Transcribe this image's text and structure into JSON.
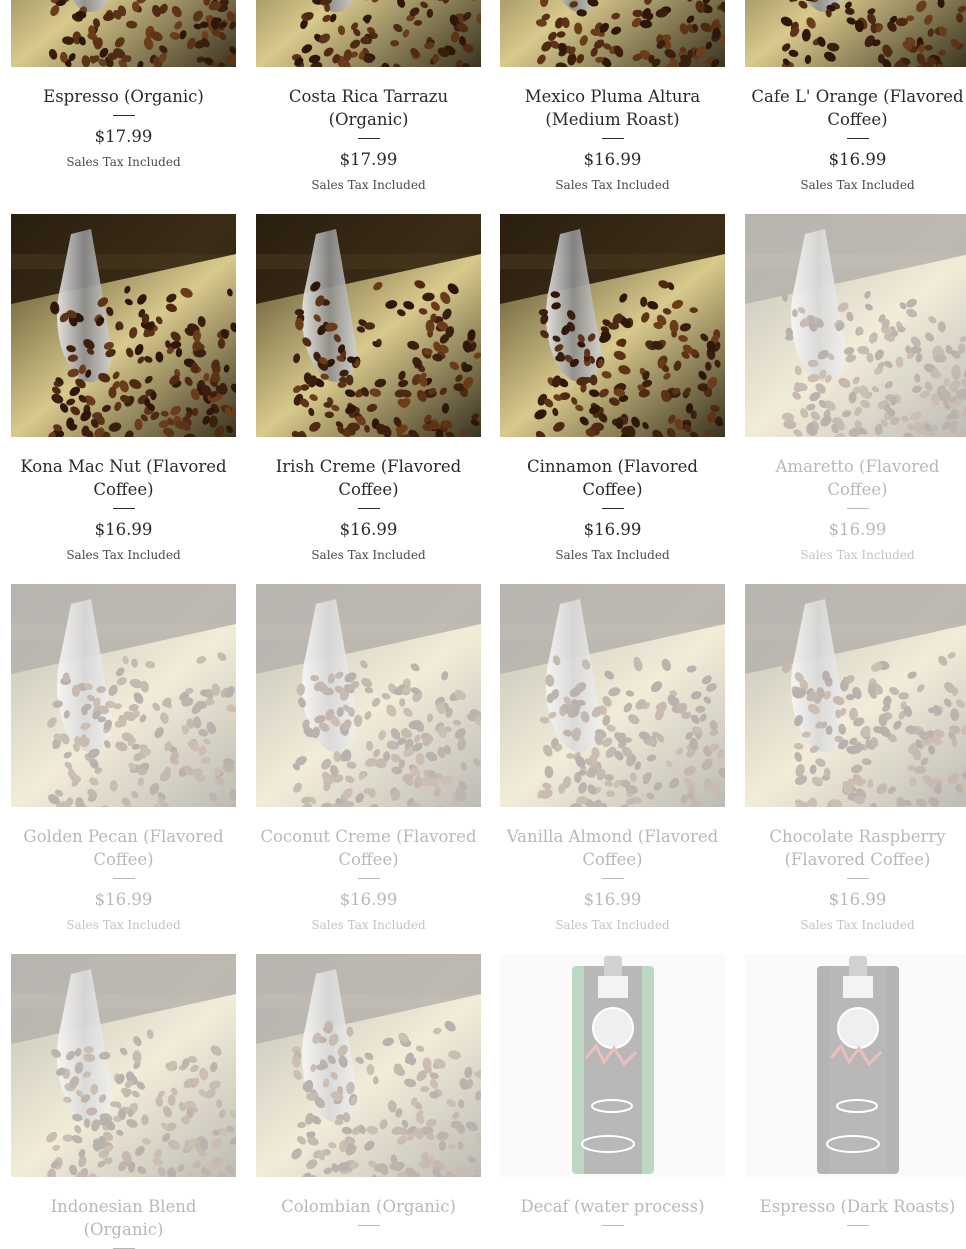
{
  "products": [
    {
      "title": "Espresso (Organic)",
      "price": "$17.99",
      "tax": "Sales Tax Included",
      "image": "coffee-scoop",
      "faded": false
    },
    {
      "title": "Costa Rica Tarrazu (Organic)",
      "price": "$17.99",
      "tax": "Sales Tax Included",
      "image": "coffee-scoop",
      "faded": false
    },
    {
      "title": "Mexico Pluma Altura (Medium Roast)",
      "price": "$16.99",
      "tax": "Sales Tax Included",
      "image": "coffee-scoop",
      "faded": false
    },
    {
      "title": "Cafe L' Orange (Flavored Coffee)",
      "price": "$16.99",
      "tax": "Sales Tax Included",
      "image": "coffee-scoop",
      "faded": false
    },
    {
      "title": "Kona Mac Nut (Flavored Coffee)",
      "price": "$16.99",
      "tax": "Sales Tax Included",
      "image": "coffee-scoop",
      "faded": false
    },
    {
      "title": "Irish Creme (Flavored Coffee)",
      "price": "$16.99",
      "tax": "Sales Tax Included",
      "image": "coffee-scoop",
      "faded": false
    },
    {
      "title": "Cinnamon (Flavored Coffee)",
      "price": "$16.99",
      "tax": "Sales Tax Included",
      "image": "coffee-scoop",
      "faded": false
    },
    {
      "title": "Amaretto (Flavored Coffee)",
      "price": "$16.99",
      "tax": "Sales Tax Included",
      "image": "coffee-scoop",
      "faded": true
    },
    {
      "title": "Golden Pecan (Flavored Coffee)",
      "price": "$16.99",
      "tax": "Sales Tax Included",
      "image": "coffee-scoop",
      "faded": true
    },
    {
      "title": "Coconut Creme (Flavored Coffee)",
      "price": "$16.99",
      "tax": "Sales Tax Included",
      "image": "coffee-scoop",
      "faded": true
    },
    {
      "title": "Vanilla Almond (Flavored Coffee)",
      "price": "$16.99",
      "tax": "Sales Tax Included",
      "image": "coffee-scoop",
      "faded": true
    },
    {
      "title": "Chocolate Raspberry (Flavored Coffee)",
      "price": "$16.99",
      "tax": "Sales Tax Included",
      "image": "coffee-scoop",
      "faded": true
    },
    {
      "title": "Indonesian Blend (Organic)",
      "price": "",
      "tax": "",
      "image": "coffee-scoop",
      "faded": true
    },
    {
      "title": "Colombian (Organic)",
      "price": "",
      "tax": "",
      "image": "coffee-scoop",
      "faded": true
    },
    {
      "title": "Decaf (water process)",
      "price": "",
      "tax": "",
      "image": "coffee-bag-green",
      "faded": true
    },
    {
      "title": "Espresso (Dark Roasts)",
      "price": "",
      "tax": "",
      "image": "coffee-bag-black",
      "faded": true
    }
  ],
  "colors": {
    "text": "#2a2a2a",
    "bean": "#4a2a14",
    "metal": "#b9a873"
  }
}
